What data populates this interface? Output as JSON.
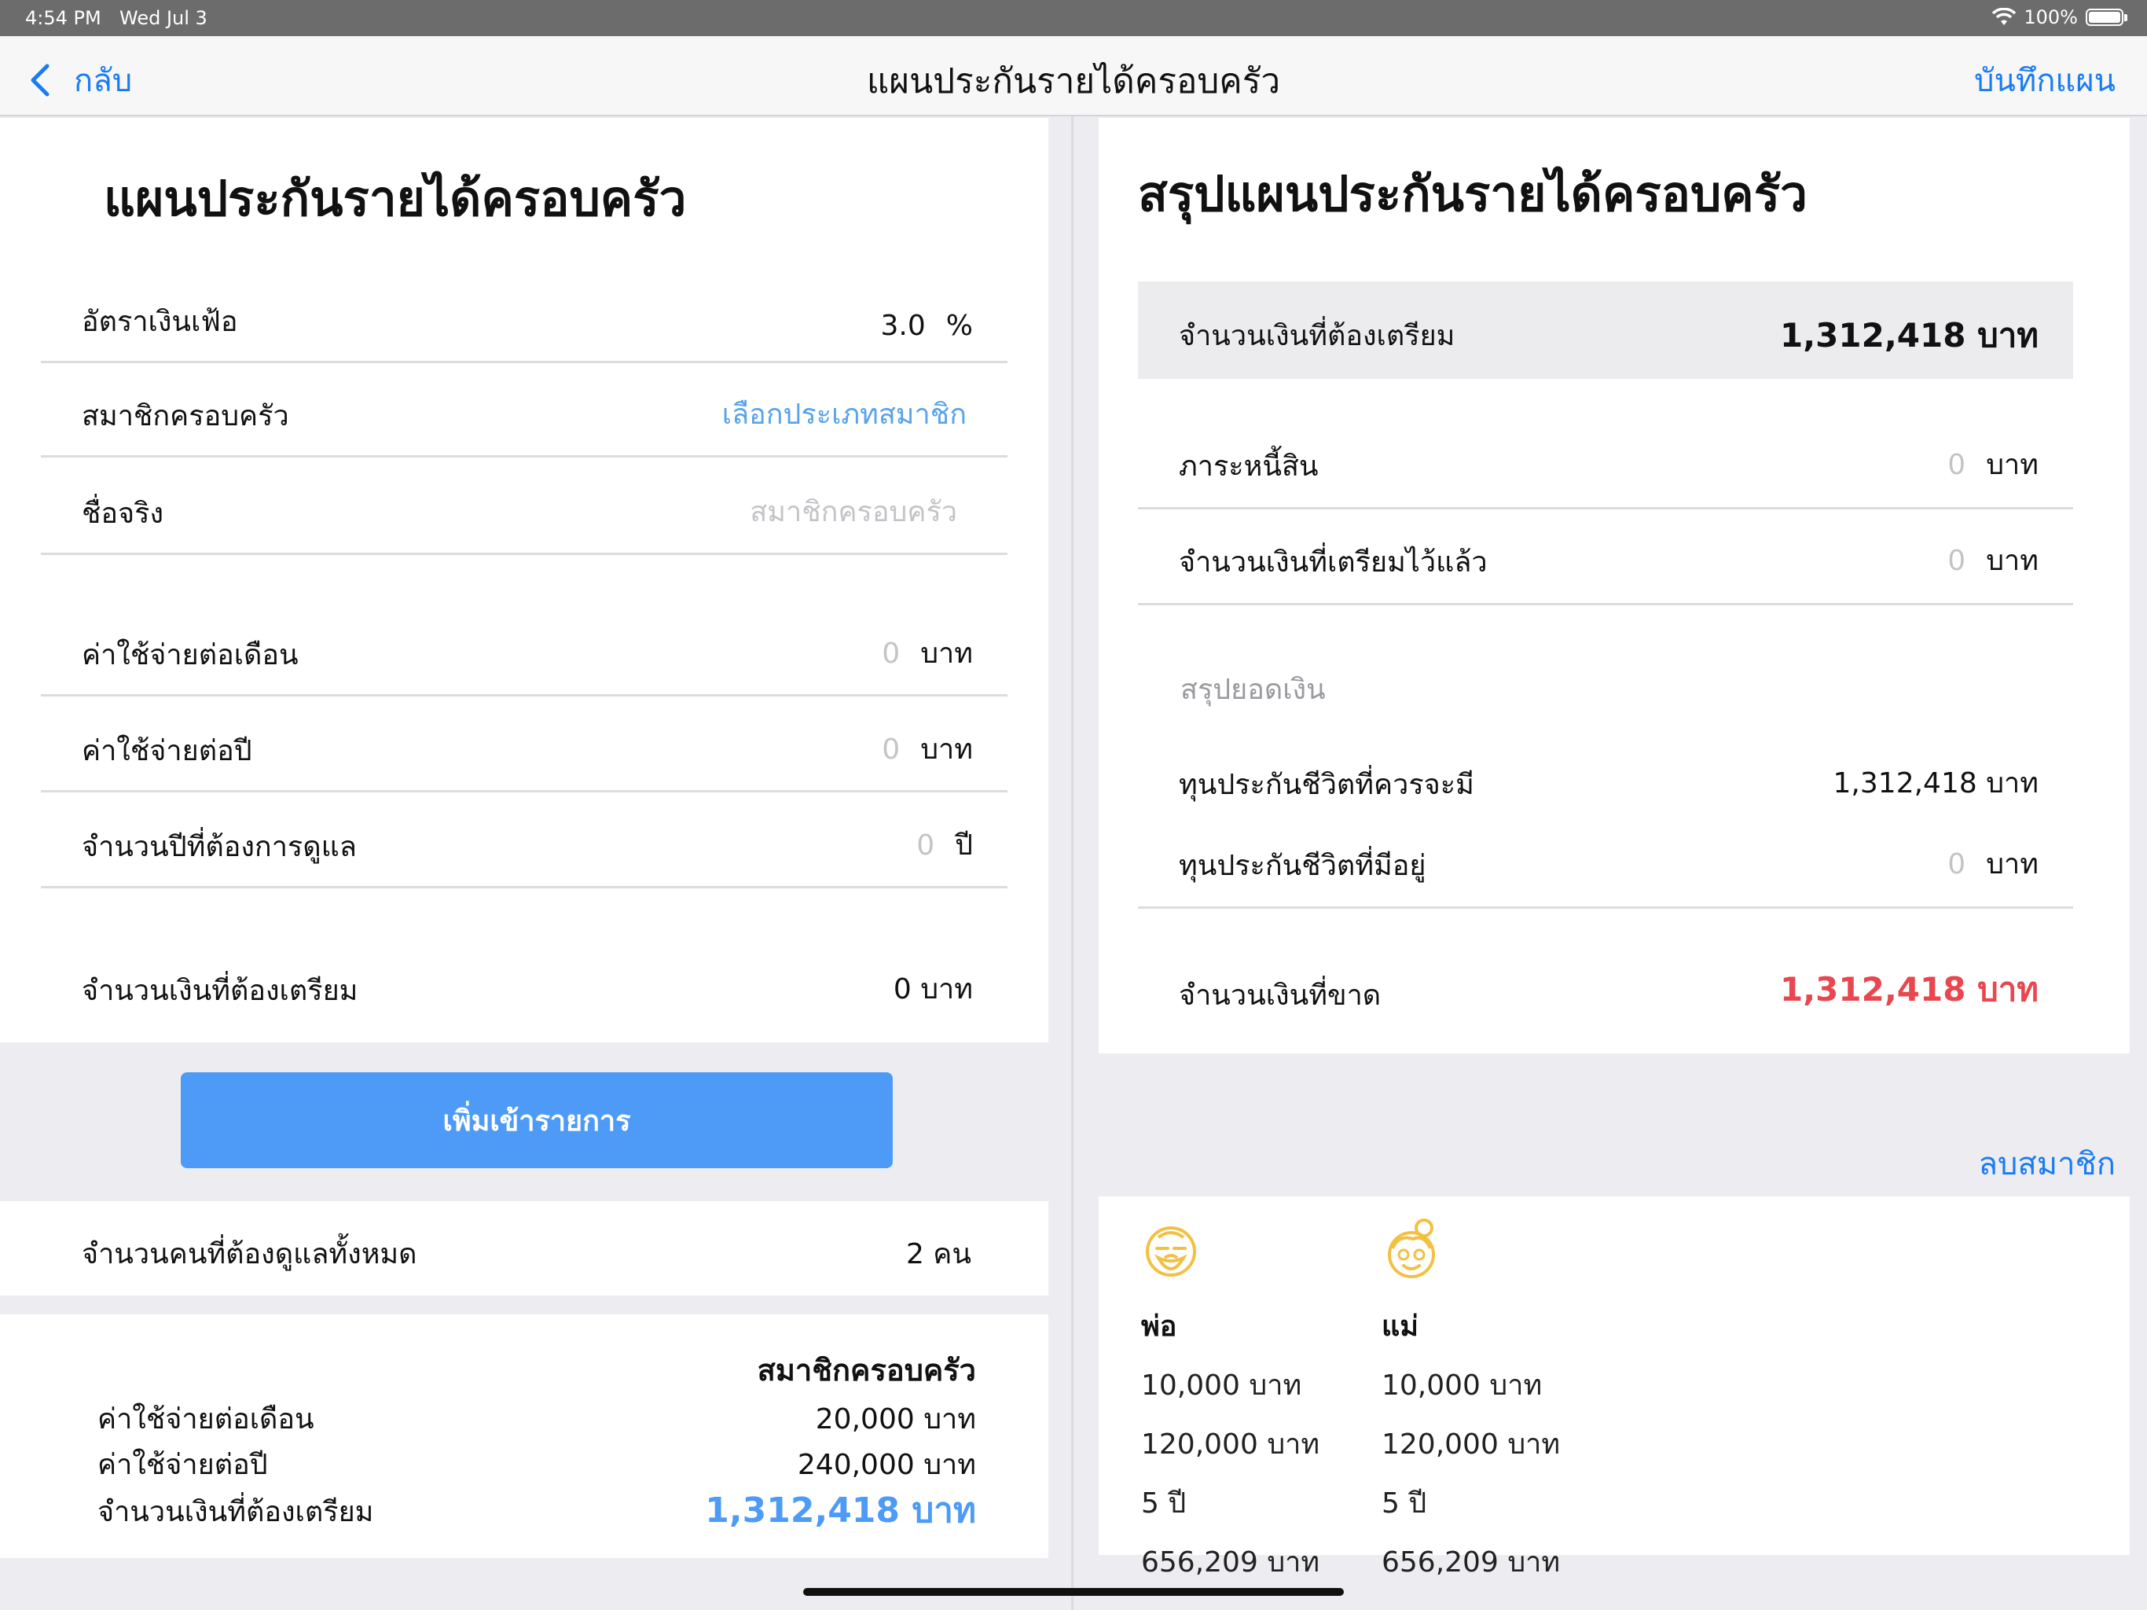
{
  "status_bar": {
    "time": "4:54 PM",
    "date": "Wed Jul 3",
    "battery": "100%"
  },
  "nav": {
    "back_label": "กลับ",
    "title": "แผนประกันรายได้ครอบครัว",
    "save_label": "บันทึกแผน"
  },
  "left": {
    "title": "แผนประกันรายได้ครอบครัว",
    "inflation": {
      "label": "อัตราเงินเฟ้อ",
      "value": "3.0",
      "unit": "%"
    },
    "member_type": {
      "label": "สมาชิกครอบครัว",
      "value": "เลือกประเภทสมาชิก"
    },
    "real_name": {
      "label": "ชื่อจริง",
      "placeholder": "สมาชิกครอบครัว"
    },
    "monthly_expense": {
      "label": "ค่าใช้จ่ายต่อเดือน",
      "value": "0",
      "unit": "บาท"
    },
    "yearly_expense": {
      "label": "ค่าใช้จ่ายต่อปี",
      "value": "0",
      "unit": "บาท"
    },
    "years_care": {
      "label": "จำนวนปีที่ต้องการดูแล",
      "value": "0",
      "unit": "ปี"
    },
    "amount_prepare": {
      "label": "จำนวนเงินที่ต้องเตรียม",
      "value": "0 บาท"
    },
    "add_button": "เพิ่มเข้ารายการ",
    "people_count": {
      "label": "จำนวนคนที่ต้องดูแลทั้งหมด",
      "value": "2 คน"
    },
    "summary": {
      "header": "สมาชิกครอบครัว",
      "rows": [
        {
          "label": "ค่าใช้จ่ายต่อเดือน",
          "value": "20,000 บาท"
        },
        {
          "label": "ค่าใช้จ่ายต่อปี",
          "value": "240,000 บาท"
        },
        {
          "label": "จำนวนเงินที่ต้องเตรียม",
          "value": "1,312,418 บาท"
        }
      ]
    }
  },
  "right": {
    "title": "สรุปแผนประกันรายได้ครอบครัว",
    "prepare": {
      "label": "จำนวนเงินที่ต้องเตรียม",
      "value": "1,312,418 บาท"
    },
    "debt": {
      "label": "ภาระหนี้สิน",
      "value": "0",
      "unit": "บาท"
    },
    "prepared_already": {
      "label": "จำนวนเงินที่เตรียมไว้แล้ว",
      "value": "0",
      "unit": "บาท"
    },
    "section_label": "สรุปยอดเงิน",
    "insurance_should": {
      "label": "ทุนประกันชีวิตที่ควรจะมี",
      "value": "1,312,418 บาท"
    },
    "insurance_have": {
      "label": "ทุนประกันชีวิตที่มีอยู่",
      "value": "0",
      "unit": "บาท"
    },
    "shortfall": {
      "label": "จำนวนเงินที่ขาด",
      "value": "1,312,418 บาท"
    },
    "delete_member": "ลบสมาชิก",
    "members": [
      {
        "name": "พ่อ",
        "monthly": "10,000 บาท",
        "yearly": "120,000 บาท",
        "years": "5 ปี",
        "total": "656,209 บาท"
      },
      {
        "name": "แม่",
        "monthly": "10,000 บาท",
        "yearly": "120,000 บาท",
        "years": "5 ปี",
        "total": "656,209 บาท"
      }
    ]
  },
  "colors": {
    "accent": "#1b7cf2",
    "button": "#4d9bf7",
    "danger": "#e8474f",
    "avatar": "#f2c043"
  }
}
